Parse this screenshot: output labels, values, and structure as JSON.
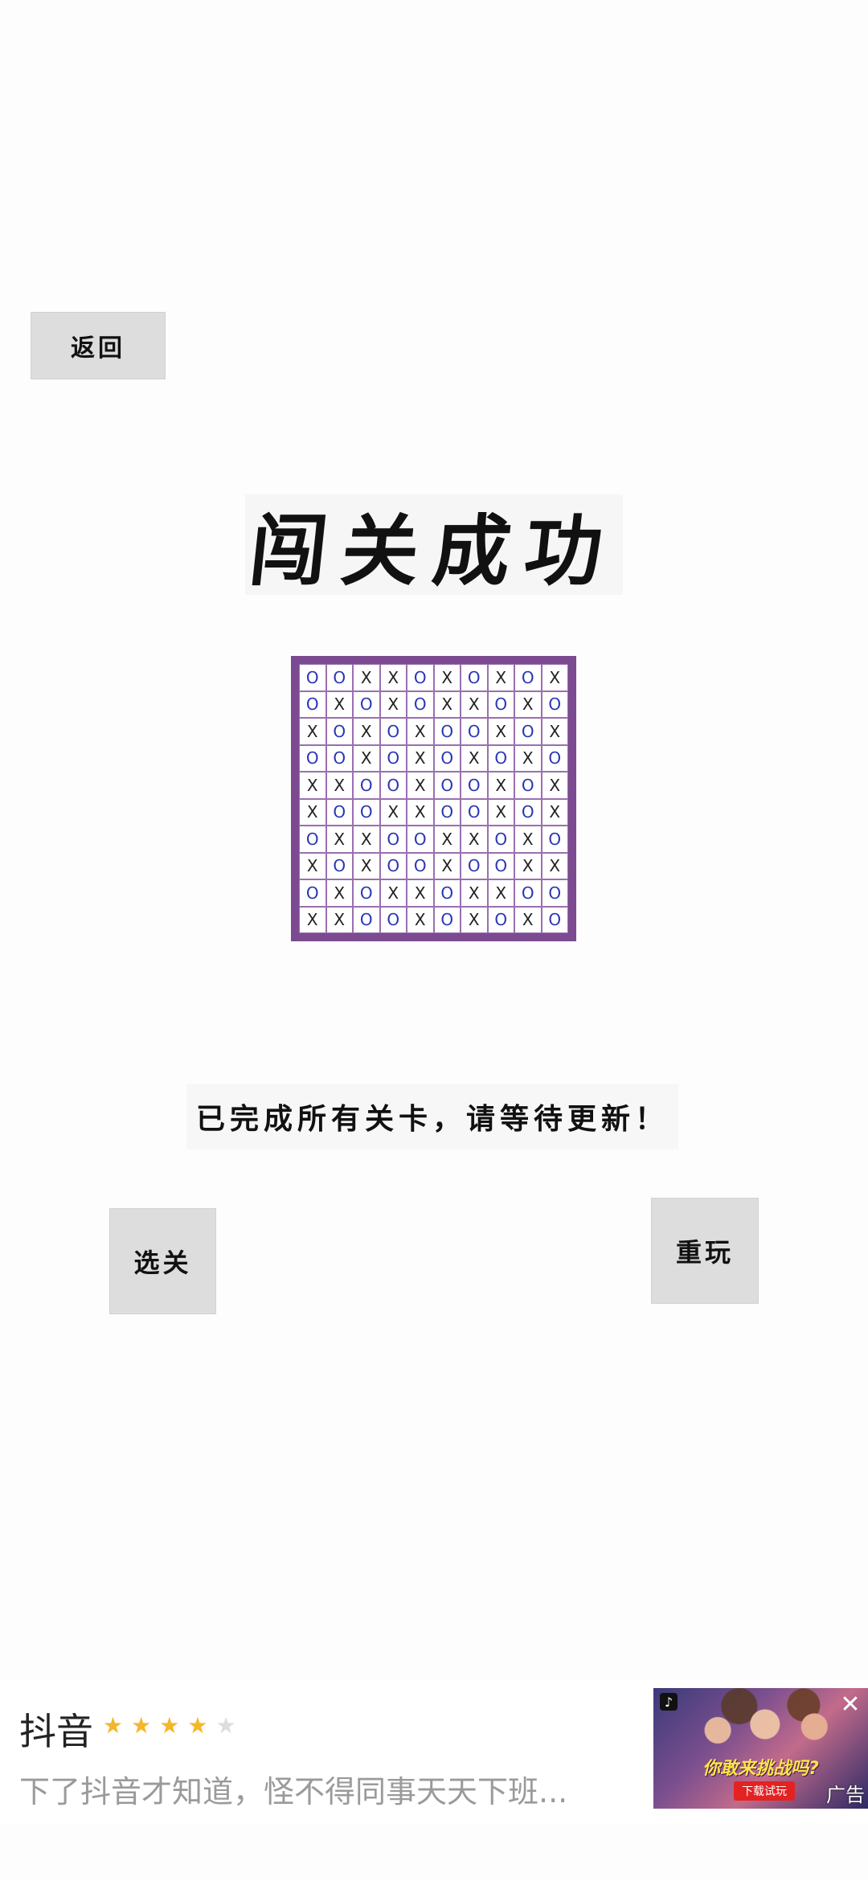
{
  "buttons": {
    "back": "返回",
    "level_select": "选关",
    "replay": "重玩"
  },
  "title": "闯关成功",
  "board": {
    "rows": [
      [
        "O",
        "O",
        "X",
        "X",
        "O",
        "X",
        "O",
        "X",
        "O",
        "X"
      ],
      [
        "O",
        "X",
        "O",
        "X",
        "O",
        "X",
        "X",
        "O",
        "X",
        "O"
      ],
      [
        "X",
        "O",
        "X",
        "O",
        "X",
        "O",
        "O",
        "X",
        "O",
        "X"
      ],
      [
        "O",
        "O",
        "X",
        "O",
        "X",
        "O",
        "X",
        "O",
        "X",
        "O"
      ],
      [
        "X",
        "X",
        "O",
        "O",
        "X",
        "O",
        "O",
        "X",
        "O",
        "X"
      ],
      [
        "X",
        "O",
        "O",
        "X",
        "X",
        "O",
        "O",
        "X",
        "O",
        "X"
      ],
      [
        "O",
        "X",
        "X",
        "O",
        "O",
        "X",
        "X",
        "O",
        "X",
        "O"
      ],
      [
        "X",
        "O",
        "X",
        "O",
        "O",
        "X",
        "O",
        "O",
        "X",
        "X"
      ],
      [
        "O",
        "X",
        "O",
        "X",
        "X",
        "O",
        "X",
        "X",
        "O",
        "O"
      ],
      [
        "X",
        "X",
        "O",
        "O",
        "X",
        "O",
        "X",
        "O",
        "X",
        "O"
      ]
    ],
    "border_color": "#7c4a90",
    "o_color": "#2b36b5"
  },
  "message": "已完成所有关卡，请等待更新！",
  "ad": {
    "app_name": "抖音",
    "rating": 4,
    "rating_max": 5,
    "description": "下了抖音才知道，怪不得同事天天下班...",
    "image_slogan": "你敢来挑战吗?",
    "image_button": "下载试玩",
    "label": "广告",
    "close_icon": "close-icon",
    "logo_icon": "tiktok-logo-icon"
  }
}
